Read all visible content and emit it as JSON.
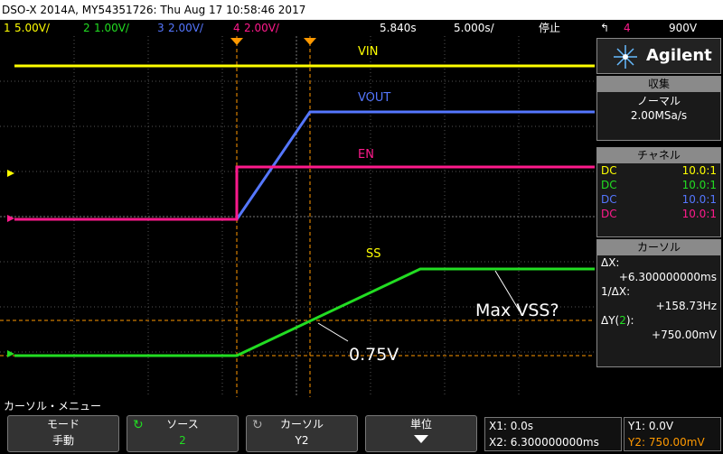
{
  "title_bar": "DSO-X 2014A, MY54351726: Thu Aug 17 10:58:46 2017",
  "channel_bar": {
    "ch1": {
      "num": "1",
      "scale": "5.00V/"
    },
    "ch2": {
      "num": "2",
      "scale": "1.00V/"
    },
    "ch3": {
      "num": "3",
      "scale": "2.00V/"
    },
    "ch4": {
      "num": "4",
      "scale": "2.00V/"
    },
    "time_offset": "5.840s",
    "time_scale": "5.000s/",
    "run_state": "停止",
    "trigger_source": "4",
    "trigger_level": "900V"
  },
  "colors": {
    "ch1": "#ffff00",
    "ch2": "#22dd22",
    "ch3": "#5577ff",
    "ch4": "#ff1a8c",
    "cursor": "#ff9900",
    "grid": "#555555"
  },
  "waveform_labels": {
    "vin": "VIN",
    "vout": "VOUT",
    "en": "EN",
    "ss": "SS",
    "annot_max": "Max VSS?",
    "annot_075": "0.75V"
  },
  "brand": {
    "logo_text": "Agilent",
    "icon": "agilent-spark-icon"
  },
  "acquisition": {
    "header": "収集",
    "mode": "ノーマル",
    "rate": "2.00MSa/s"
  },
  "channels_panel": {
    "header": "チャネル",
    "rows": [
      {
        "coupling": "DC",
        "probe": "10.0:1",
        "color": "#ffff00"
      },
      {
        "coupling": "DC",
        "probe": "10.0:1",
        "color": "#22dd22"
      },
      {
        "coupling": "DC",
        "probe": "10.0:1",
        "color": "#5577ff"
      },
      {
        "coupling": "DC",
        "probe": "10.0:1",
        "color": "#ff1a8c"
      }
    ]
  },
  "cursor_panel": {
    "header": "カーソル",
    "dx_label": "ΔX:",
    "dx_value": "+6.300000000ms",
    "inv_dx_label": "1/ΔX:",
    "inv_dx_value": "+158.73Hz",
    "dy_label_pre": "ΔY(",
    "dy_label_ch": "2",
    "dy_label_post": "):",
    "dy_value": "+750.00mV"
  },
  "menu": {
    "title": "カーソル・メニュー",
    "mode": {
      "label": "モード",
      "value": "手動"
    },
    "source": {
      "label": "ソース",
      "value": "2"
    },
    "cursor": {
      "label": "カーソル",
      "value": "Y2"
    },
    "units": {
      "label": "単位"
    }
  },
  "readouts": {
    "x1": "X1: 0.0s",
    "x2": "X2: 6.300000000ms",
    "y1": "Y1: 0.0V",
    "y2": "Y2: 750.00mV"
  }
}
